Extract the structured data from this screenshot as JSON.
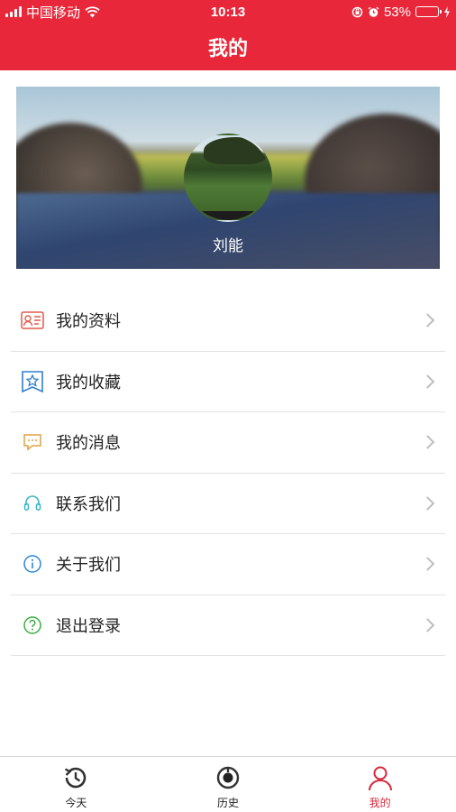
{
  "status_bar": {
    "carrier": "中国移动",
    "time": "10:13",
    "battery_percent": "53%",
    "battery_level": 0.53,
    "icons": [
      "signal-icon",
      "wifi-icon",
      "orientation-lock-icon",
      "alarm-icon",
      "battery-icon",
      "charging-icon"
    ]
  },
  "header": {
    "title": "我的"
  },
  "profile": {
    "username": "刘能"
  },
  "menu": {
    "items": [
      {
        "label": "我的资料",
        "icon": "profile-card-icon",
        "color": "#e05a4a"
      },
      {
        "label": "我的收藏",
        "icon": "favorite-star-icon",
        "color": "#2f7fd0"
      },
      {
        "label": "我的消息",
        "icon": "message-icon",
        "color": "#e0a040"
      },
      {
        "label": "联系我们",
        "icon": "headset-icon",
        "color": "#3bb6c8"
      },
      {
        "label": "关于我们",
        "icon": "info-icon",
        "color": "#2f86d6"
      },
      {
        "label": "退出登录",
        "icon": "help-circle-icon",
        "color": "#3aae44"
      }
    ]
  },
  "tabbar": {
    "tabs": [
      {
        "label": "今天",
        "icon": "history-clock-icon",
        "active": false
      },
      {
        "label": "历史",
        "icon": "record-icon",
        "active": false
      },
      {
        "label": "我的",
        "icon": "person-icon",
        "active": true
      }
    ],
    "active_color": "#d6283a"
  },
  "colors": {
    "brand": "#e8283a",
    "divider": "#e2e2e2"
  }
}
